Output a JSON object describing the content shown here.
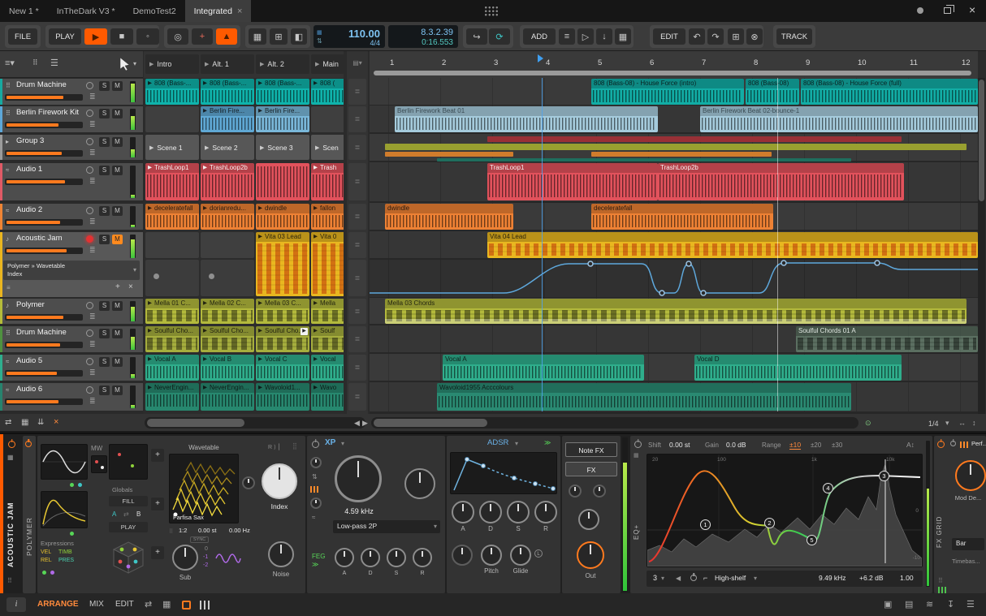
{
  "tabbar": {
    "tabs": [
      "New 1 *",
      "InTheDark V3 *",
      "DemoTest2",
      "Integrated"
    ],
    "close": "×"
  },
  "toolbar": {
    "file": "FILE",
    "play": "PLAY",
    "tempo": "110.00",
    "timesig": "4/4",
    "pos_bars": "8.3.2.39",
    "pos_time": "0:16.553",
    "add": "ADD",
    "edit": "EDIT",
    "track": "TRACK"
  },
  "scenes": [
    "Intro",
    "Alt. 1",
    "Alt. 2",
    "Main"
  ],
  "ruler": [
    "1",
    "2",
    "3",
    "4",
    "5",
    "6",
    "7",
    "8",
    "9",
    "10",
    "11",
    "12"
  ],
  "zoom": "1/4",
  "btn": {
    "solo": "S",
    "mute": "M"
  },
  "tracks": [
    "Drum Machine",
    "Berlin Firework Kit",
    "Group 3",
    "Audio 1",
    "Audio 2",
    "Acoustic Jam",
    "Polymer",
    "Drum Machine",
    "Audio 5",
    "Audio 6"
  ],
  "track_device": {
    "line1": "Polymer » Wavetable",
    "line2": "Index"
  },
  "launcher": {
    "r1": [
      "808 (Bass-...",
      "808 (Bass-...",
      "808 (Bass-...",
      "808 ("
    ],
    "r2": [
      "",
      "Berlin Fire...",
      "Berlin Fire...",
      ""
    ],
    "r3": [
      "Scene 1",
      "Scene 2",
      "Scene 3",
      "Scen"
    ],
    "r4": [
      "TrashLoop1",
      "TrashLoop2b",
      "",
      "Trash"
    ],
    "r5": [
      "deceleratefall",
      "dorianredu...",
      "dwindle",
      "fallon"
    ],
    "r6": [
      "",
      "",
      "Vita 03 Lead",
      "Vita 0"
    ],
    "r7": [
      "Mella 01 C...",
      "Mella 02 C...",
      "Mella 03 C...",
      "Mella"
    ],
    "r8": [
      "Soulful Cho...",
      "Soulful Cho...",
      "Soulful Cho...",
      "Soulf"
    ],
    "r9": [
      "Vocal A",
      "Vocal B",
      "Vocal C",
      "Vocal"
    ],
    "r10": [
      "NeverEngin...",
      "NeverEngin...",
      "Wavoloid1...",
      "Wavo"
    ]
  },
  "arr": {
    "t1a": "808 (Bass-08) - House Force (intro)",
    "t1b": "808 (Bass-08)",
    "t1c": "808 (Bass-08) - House Force (full)",
    "t2a": "Berlin Firework Beat 01",
    "t2b": "Berlin Firework Beat 02-bounce-1",
    "t4a": "TrashLoop1",
    "t4b": "TrashLoop2b",
    "t5a": "dwindle",
    "t5b": "deceleratefall",
    "t6a": "Vita 04 Lead",
    "t7a": "Mella 03 Chords",
    "t8a": "Soulful Chords 01 A",
    "t9a": "Vocal A",
    "t9b": "Vocal D",
    "t10a": "Wavoloid1955 Acccolours"
  },
  "device": {
    "track": "ACOUSTIC JAM",
    "polymer": {
      "name": "POLYMER",
      "mw": "MW",
      "globals": "Globals",
      "fill": "FILL",
      "a": "A",
      "b": "B",
      "play": "PLAY",
      "expressions": "Expressions",
      "vel": "VEL",
      "timb": "TIMB",
      "rel": "REL",
      "pres": "PRES",
      "wavetable": "Wavetable",
      "wave": "Farfisa Sax",
      "index": "Index",
      "ratio": "1:2",
      "st": "0.00 st",
      "hz": "0.00 Hz",
      "sync": "SYNC",
      "sub": "Sub",
      "oct0": "0",
      "oct1": "-1",
      "oct2": "-2",
      "noise": "Noise"
    },
    "xp": {
      "name": "XP",
      "freq": "4.59 kHz",
      "mode": "Low-pass 2P",
      "feg": "FEG",
      "a": "A",
      "d": "D",
      "s": "S",
      "r": "R"
    },
    "env": {
      "name": "ADSR",
      "a": "A",
      "d": "D",
      "s": "S",
      "r": "R",
      "pitch": "Pitch",
      "glide": "Glide",
      "latch": "L",
      "out": "Out"
    },
    "fxtabs": {
      "notefx": "Note FX",
      "fx": "FX"
    },
    "eq": {
      "label": "EQ+",
      "shift": "Shift",
      "shift_v": "0.00 st",
      "gain": "Gain",
      "gain_v": "0.0 dB",
      "range": "Range",
      "r10": "±10",
      "r20": "±20",
      "r30": "±30",
      "f20": "20",
      "f100": "100",
      "f1k": "1k",
      "f10k": "10k",
      "db0": "0",
      "db10": "-10",
      "m1": "1",
      "m2": "2",
      "m3": "3",
      "m4": "4",
      "m5": "5",
      "sel": "3",
      "type": "High-shelf",
      "freq": "9.49 kHz",
      "gain_band": "+6.2 dB",
      "q": "1.00"
    },
    "grid": {
      "label": "FX GRID",
      "perf": "Perf...",
      "mod": "Mod De...",
      "bar": "Bar",
      "timebase": "Timebas..."
    }
  },
  "status": {
    "arrange": "ARRANGE",
    "mix": "MIX",
    "edit": "EDIT"
  }
}
